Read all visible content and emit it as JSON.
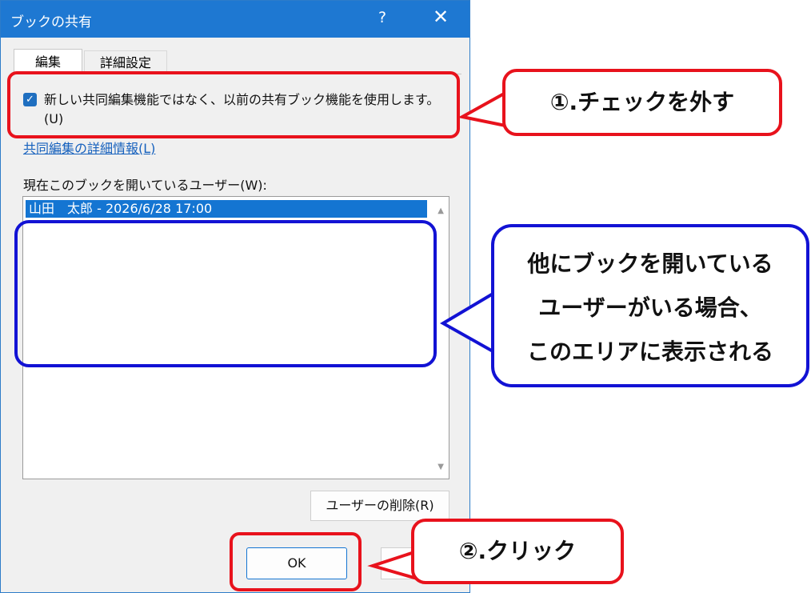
{
  "dialog": {
    "title": "ブックの共有",
    "help_glyph": "?",
    "close_glyph": "✕",
    "tabs": [
      {
        "label": "編集",
        "active": true
      },
      {
        "label": "詳細設定",
        "active": false
      }
    ],
    "checkbox": {
      "label": "新しい共同編集機能ではなく、以前の共有ブック機能を使用します。(U)",
      "checked": true,
      "check_glyph": "✓"
    },
    "link_text": "共同編集の詳細情報(L)",
    "users_label": "現在このブックを開いているユーザー(W):",
    "users": [
      "山田　太郎 - 2026/6/28 17:00"
    ],
    "scroll_up_glyph": "▲",
    "scroll_down_glyph": "▼",
    "remove_button": "ユーザーの削除(R)",
    "ok_button": "OK"
  },
  "annotations": {
    "callout_uncheck": "①.チェックを外す",
    "callout_area_line1": "他にブックを開いている",
    "callout_area_line2": "ユーザーがいる場合、",
    "callout_area_line3": "このエリアに表示される",
    "callout_click": "②.クリック"
  },
  "colors": {
    "titlebar": "#1e78d2",
    "highlight_red": "#e8121c",
    "highlight_blue": "#1212d4",
    "selection": "#1475d2"
  }
}
